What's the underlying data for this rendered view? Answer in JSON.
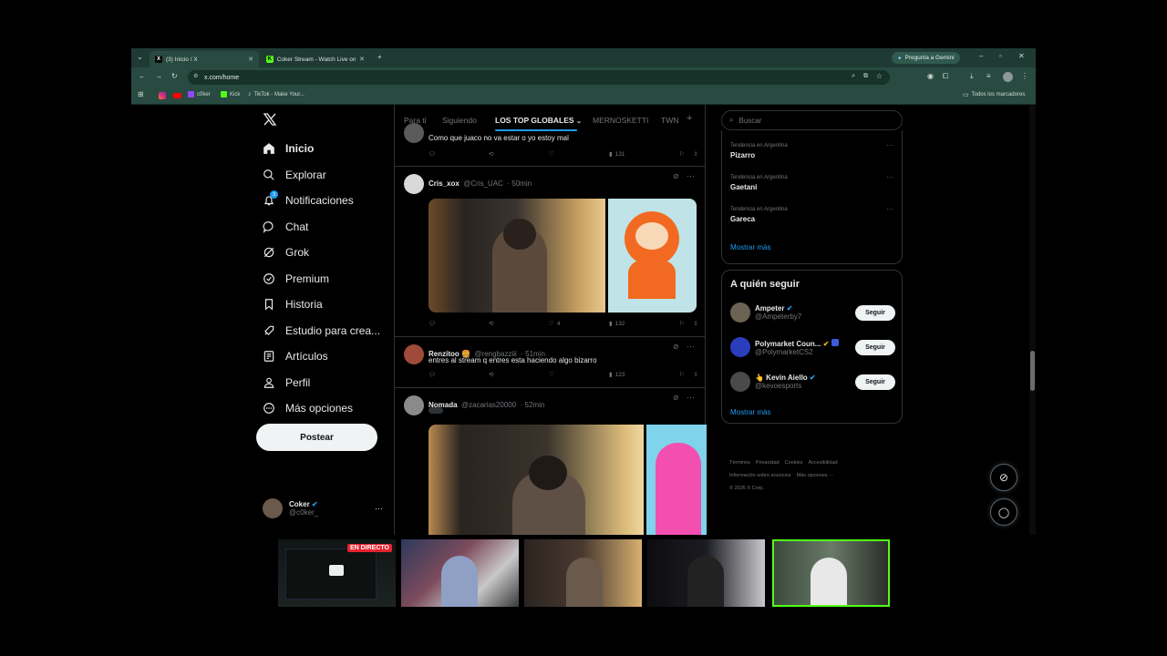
{
  "browser": {
    "tabs": [
      {
        "title": "(3) Inicio / X",
        "active": true
      },
      {
        "title": "Coker Stream - Watch Live on K",
        "active": false
      }
    ],
    "gemini_button": "Pregunta a Gemini",
    "url": "x.com/home",
    "bookmarks": [
      "c0ker",
      "Kick",
      "TikTok - Make Your..."
    ],
    "all_bookmarks": "Todos los marcadores"
  },
  "sidebar": {
    "items": [
      {
        "label": "Inicio",
        "icon": "home-icon"
      },
      {
        "label": "Explorar",
        "icon": "search-icon"
      },
      {
        "label": "Notificaciones",
        "icon": "bell-icon",
        "badge": "3"
      },
      {
        "label": "Chat",
        "icon": "chat-icon"
      },
      {
        "label": "Grok",
        "icon": "grok-icon"
      },
      {
        "label": "Premium",
        "icon": "premium-icon"
      },
      {
        "label": "Historia",
        "icon": "bookmark-icon"
      },
      {
        "label": "Estudio para crea...",
        "icon": "rocket-icon"
      },
      {
        "label": "Artículos",
        "icon": "article-icon"
      },
      {
        "label": "Perfil",
        "icon": "profile-icon"
      },
      {
        "label": "Más opciones",
        "icon": "more-circle-icon"
      }
    ],
    "post_button": "Postear",
    "account": {
      "name": "Coker",
      "handle": "@c0ker_",
      "more": "···"
    }
  },
  "timeline": {
    "tabs": [
      "Para ti",
      "Siguiendo",
      "LOS TOP GLOBALES",
      "MERNOSKETTI",
      "TWN"
    ],
    "add_tab": "+",
    "partial_tweet": {
      "text": "Como que juaco no va estar o yo estoy mal",
      "views": "131"
    },
    "tweets": [
      {
        "name": "Cris_xox",
        "handle": "@Cris_UAC",
        "time": "· 50min",
        "likes": "4",
        "views": "132"
      },
      {
        "name": "Renzitoo 🍔",
        "handle": "@rengbazziii",
        "time": "· 51min",
        "text": "entres al stream q entres esta haciendo algo bizarro",
        "views": "123"
      },
      {
        "name": "Nomada",
        "handle": "@zacarias20000",
        "time": "· 52min"
      }
    ]
  },
  "right": {
    "search_placeholder": "Buscar",
    "trends": [
      {
        "context": "Tendencia en Argentina",
        "name": "Pizarro"
      },
      {
        "context": "Tendencia en Argentina",
        "name": "Gaetani"
      },
      {
        "context": "Tendencia en Argentina",
        "name": "Gareca"
      }
    ],
    "show_more": "Mostrar más",
    "who_to_follow": {
      "title": "A quién seguir",
      "accounts": [
        {
          "name": "Ampeter",
          "handle": "@Ampeterby7"
        },
        {
          "name": "Polymarket Coun...",
          "handle": "@PolymarketCS2"
        },
        {
          "name": "👆 Kevin Aiello",
          "handle": "@kevoesports"
        }
      ],
      "follow_label": "Seguir",
      "show_more": "Mostrar más"
    },
    "footer": [
      "Términos",
      "Privacidad",
      "Cookies",
      "Accesibilidad",
      "Información sobre anuncios",
      "Más opciones ···",
      "© 2026 X Corp."
    ]
  },
  "stream_strip": {
    "live_badge": "EN DIRECTO"
  },
  "colors": {
    "accent": "#1d9bf0",
    "chrome": "#284a40",
    "live": "#e5232f"
  }
}
